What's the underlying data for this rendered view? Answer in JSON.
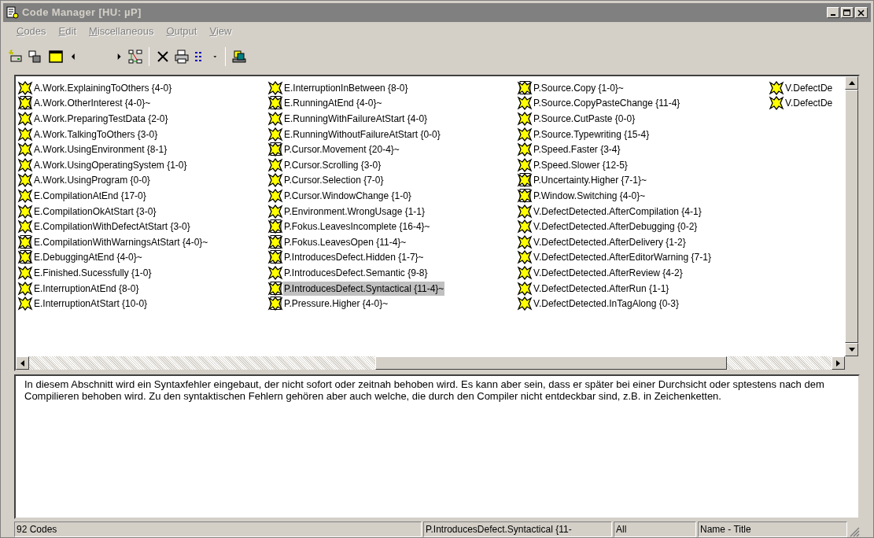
{
  "window": {
    "title": "Code Manager [HU: µP]"
  },
  "menu": [
    {
      "label": "Codes",
      "disabled": true
    },
    {
      "label": "Edit",
      "disabled": true
    },
    {
      "label": "Miscellaneous",
      "disabled": true
    },
    {
      "label": "Output",
      "disabled": true
    },
    {
      "label": "View",
      "disabled": true
    }
  ],
  "code_list": {
    "columns": [
      [
        {
          "label": "A.Work.ExplainingToOthers {4-0}",
          "kind": "code",
          "selected": false
        },
        {
          "label": "A.Work.OtherInterest {4-0}~",
          "kind": "memo",
          "selected": false
        },
        {
          "label": "A.Work.PreparingTestData {2-0}",
          "kind": "code",
          "selected": false
        },
        {
          "label": "A.Work.TalkingToOthers {3-0}",
          "kind": "code",
          "selected": false
        },
        {
          "label": "A.Work.UsingEnvironment {8-1}",
          "kind": "code",
          "selected": false
        },
        {
          "label": "A.Work.UsingOperatingSystem {1-0}",
          "kind": "code",
          "selected": false
        },
        {
          "label": "A.Work.UsingProgram {0-0}",
          "kind": "code",
          "selected": false
        },
        {
          "label": "E.CompilationAtEnd {17-0}",
          "kind": "code",
          "selected": false
        },
        {
          "label": "E.CompilationOkAtStart {3-0}",
          "kind": "code",
          "selected": false
        },
        {
          "label": "E.CompilationWithDefectAtStart {3-0}",
          "kind": "code",
          "selected": false
        },
        {
          "label": "E.CompilationWithWarningsAtStart {4-0}~",
          "kind": "memo",
          "selected": false
        },
        {
          "label": "E.DebuggingAtEnd {4-0}~",
          "kind": "memo",
          "selected": false
        },
        {
          "label": "E.Finished.Sucessfully {1-0}",
          "kind": "code",
          "selected": false
        },
        {
          "label": "E.InterruptionAtEnd {8-0}",
          "kind": "code",
          "selected": false
        },
        {
          "label": "E.InterruptionAtStart {10-0}",
          "kind": "code",
          "selected": false
        }
      ],
      [
        {
          "label": "E.InterruptionInBetween {8-0}",
          "kind": "code",
          "selected": false
        },
        {
          "label": "E.RunningAtEnd {4-0}~",
          "kind": "memo",
          "selected": false
        },
        {
          "label": "E.RunningWithFailureAtStart {4-0}",
          "kind": "code",
          "selected": false
        },
        {
          "label": "E.RunningWithoutFailureAtStart {0-0}",
          "kind": "code",
          "selected": false
        },
        {
          "label": "P.Cursor.Movement {20-4}~",
          "kind": "memo",
          "selected": false
        },
        {
          "label": "P.Cursor.Scrolling {3-0}",
          "kind": "code",
          "selected": false
        },
        {
          "label": "P.Cursor.Selection {7-0}",
          "kind": "code",
          "selected": false
        },
        {
          "label": "P.Cursor.WindowChange {1-0}",
          "kind": "code",
          "selected": false
        },
        {
          "label": "P.Environment.WrongUsage {1-1}",
          "kind": "code",
          "selected": false
        },
        {
          "label": "P.Fokus.LeavesIncomplete {16-4}~",
          "kind": "memo",
          "selected": false
        },
        {
          "label": "P.Fokus.LeavesOpen {11-4}~",
          "kind": "memo",
          "selected": false
        },
        {
          "label": "P.IntroducesDefect.Hidden {1-7}~",
          "kind": "memo",
          "selected": false
        },
        {
          "label": "P.IntroducesDefect.Semantic {9-8}",
          "kind": "code",
          "selected": false
        },
        {
          "label": "P.IntroducesDefect.Syntactical {11-4}~",
          "kind": "memo",
          "selected": true
        },
        {
          "label": "P.Pressure.Higher {4-0}~",
          "kind": "memo",
          "selected": false
        }
      ],
      [
        {
          "label": "P.Source.Copy {1-0}~",
          "kind": "memo",
          "selected": false
        },
        {
          "label": "P.Source.CopyPasteChange {11-4}",
          "kind": "code",
          "selected": false
        },
        {
          "label": "P.Source.CutPaste {0-0}",
          "kind": "code",
          "selected": false
        },
        {
          "label": "P.Source.Typewriting {15-4}",
          "kind": "code",
          "selected": false
        },
        {
          "label": "P.Speed.Faster {3-4}",
          "kind": "code",
          "selected": false
        },
        {
          "label": "P.Speed.Slower {12-5}",
          "kind": "code",
          "selected": false
        },
        {
          "label": "P.Uncertainty.Higher {7-1}~",
          "kind": "memo",
          "selected": false
        },
        {
          "label": "P.Window.Switching {4-0}~",
          "kind": "memo",
          "selected": false
        },
        {
          "label": "V.DefectDetected.AfterCompilation {4-1}",
          "kind": "code",
          "selected": false
        },
        {
          "label": "V.DefectDetected.AfterDebugging {0-2}",
          "kind": "code",
          "selected": false
        },
        {
          "label": "V.DefectDetected.AfterDelivery {1-2}",
          "kind": "code",
          "selected": false
        },
        {
          "label": "V.DefectDetected.AfterEditorWarning {7-1}",
          "kind": "code",
          "selected": false
        },
        {
          "label": "V.DefectDetected.AfterReview {4-2}",
          "kind": "code",
          "selected": false
        },
        {
          "label": "V.DefectDetected.AfterRun {1-1}",
          "kind": "code",
          "selected": false
        },
        {
          "label": "V.DefectDetected.InTagAlong {0-3}",
          "kind": "code",
          "selected": false
        }
      ],
      [
        {
          "label": "V.DefectDe",
          "kind": "code",
          "selected": false
        },
        {
          "label": "V.DefectDe",
          "kind": "code",
          "selected": false
        }
      ]
    ]
  },
  "description": "In diesem Abschnitt wird ein Syntaxfehler eingebaut, der nicht sofort oder zeitnah behoben wird. Es kann aber sein, dass er später bei einer Durchsicht oder sptestens nach dem Compilieren behoben wird. Zu den syntaktischen Fehlern gehören aber auch welche, die durch den Compiler nicht entdeckbar sind, z.B. in Zeichenketten.",
  "status_bar": [
    "92 Codes",
    "P.IntroducesDefect.Syntactical {11-",
    "All",
    "Name - Title"
  ]
}
